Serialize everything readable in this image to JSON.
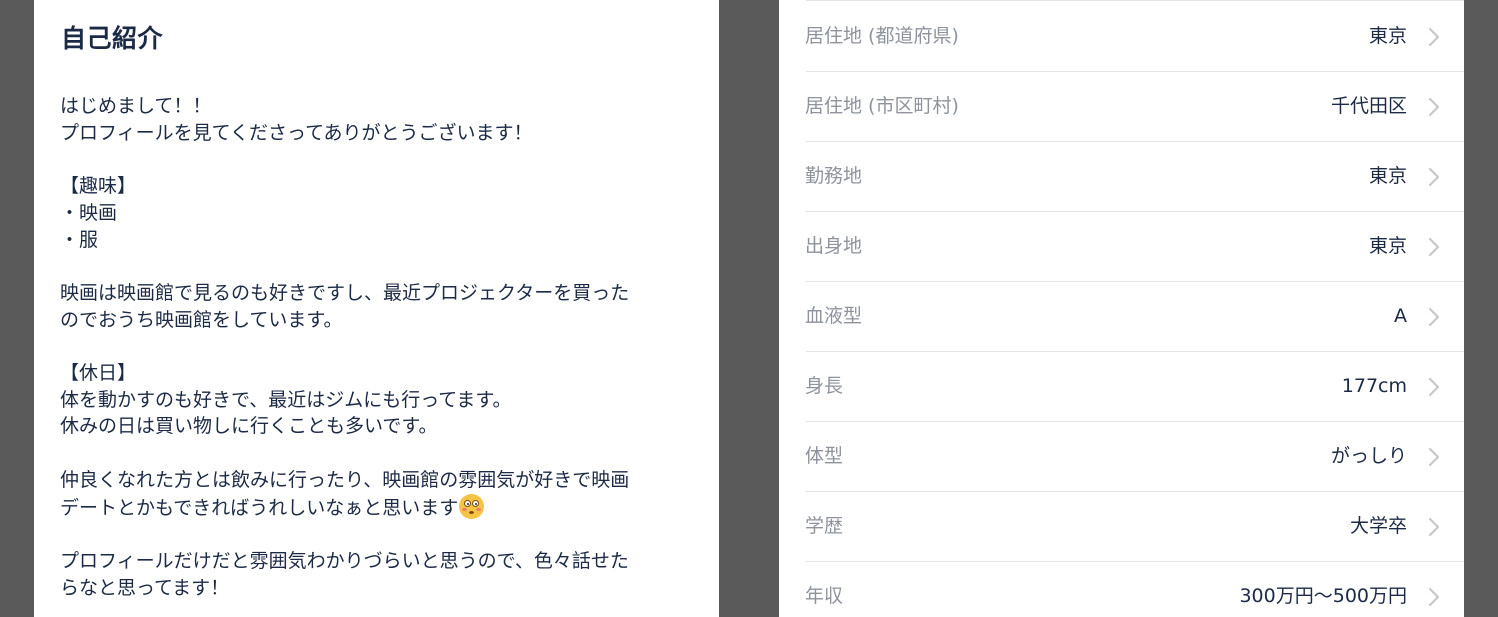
{
  "intro": {
    "title": "自己紹介",
    "line_1": "はじめまして！！",
    "line_2": "プロフィールを見てくださってありがとうございます！",
    "line_3": "【趣味】",
    "line_4": "・映画",
    "line_5": "・服",
    "line_6": "映画は映画館で見るのも好きですし、最近プロジェクターを買った",
    "line_7": "のでおうち映画館をしています。",
    "line_8": "【休日】",
    "line_9": "体を動かすのも好きで、最近はジムにも行ってます。",
    "line_10": "休みの日は買い物しに行くことも多いです。",
    "line_11": "仲良くなれた方とは飲みに行ったり、映画館の雰囲気が好きで映画",
    "line_12": "デートとかもできればうれしいなぁと思います",
    "line_13": "プロフィールだけだと雰囲気わかりづらいと思うので、色々話せた",
    "line_14": "らなと思ってます！",
    "emoji_icon": "flushed-face-emoji"
  },
  "profile": {
    "items": [
      {
        "label": "居住地 (都道府県)",
        "value": "東京"
      },
      {
        "label": "居住地 (市区町村)",
        "value": "千代田区"
      },
      {
        "label": "勤務地",
        "value": "東京"
      },
      {
        "label": "出身地",
        "value": "東京"
      },
      {
        "label": "血液型",
        "value": "A"
      },
      {
        "label": "身長",
        "value": "177cm"
      },
      {
        "label": "体型",
        "value": "がっしり"
      },
      {
        "label": "学歴",
        "value": "大学卒"
      },
      {
        "label": "年収",
        "value": "300万円〜500万円"
      }
    ],
    "row_icon": "chevron-right-icon"
  },
  "colors": {
    "background": "#5a5a5a",
    "panel": "#ffffff",
    "text_primary": "#1c2a45",
    "text_label": "#8e939c",
    "chevron": "#c8c8cc",
    "divider": "#e5e5e5"
  }
}
